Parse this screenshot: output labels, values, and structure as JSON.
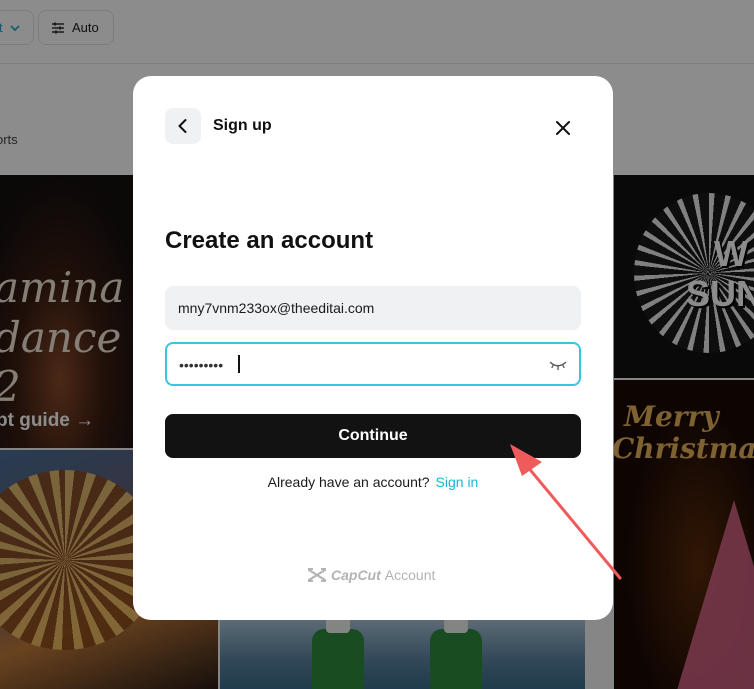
{
  "background": {
    "toolbar": {
      "first_button_label": "t",
      "auto_label": "Auto"
    },
    "subbar_text": "orts",
    "tiles": {
      "tile1_line1": "amina",
      "tile1_line2": "dance 2",
      "tile1_link": "pt guide →",
      "tile4_word1": "W",
      "tile4_word2": "SUN",
      "tile5_line1": "Merry",
      "tile5_line2": "Christmas"
    }
  },
  "modal": {
    "header_title": "Sign up",
    "heading": "Create an account",
    "email_value": "mny7vnm233ox@theeditai.com",
    "password_mask": "•••••••••",
    "continue_label": "Continue",
    "signin_prompt": "Already have an account?",
    "signin_link": "Sign in",
    "brand_name": "CapCut",
    "brand_suffix": "Account"
  },
  "colors": {
    "accent": "#39c5e0",
    "link": "#19b6d6",
    "primary_button": "#121212",
    "annotation_arrow": "#ef5b5b"
  },
  "icons": {
    "back": "chevron-left-icon",
    "close": "close-icon",
    "password_toggle": "eye-closed-icon",
    "brand": "capcut-logo-icon",
    "toolbar_adjust": "sliders-icon"
  }
}
